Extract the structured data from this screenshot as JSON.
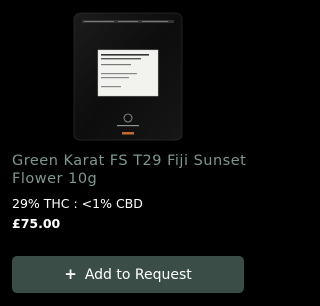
{
  "product": {
    "image_icon": "product-package-image",
    "title": "Green Karat FS T29 Fiji Sunset Flower 10g",
    "potency": "29% THC : <1% CBD",
    "price": "£75.00"
  },
  "actions": {
    "add_icon": "plus-icon",
    "add_label": "Add to Request"
  },
  "colors": {
    "background": "#000000",
    "title": "#7f978c",
    "button": "#3a4d46",
    "text": "#ffffff"
  }
}
